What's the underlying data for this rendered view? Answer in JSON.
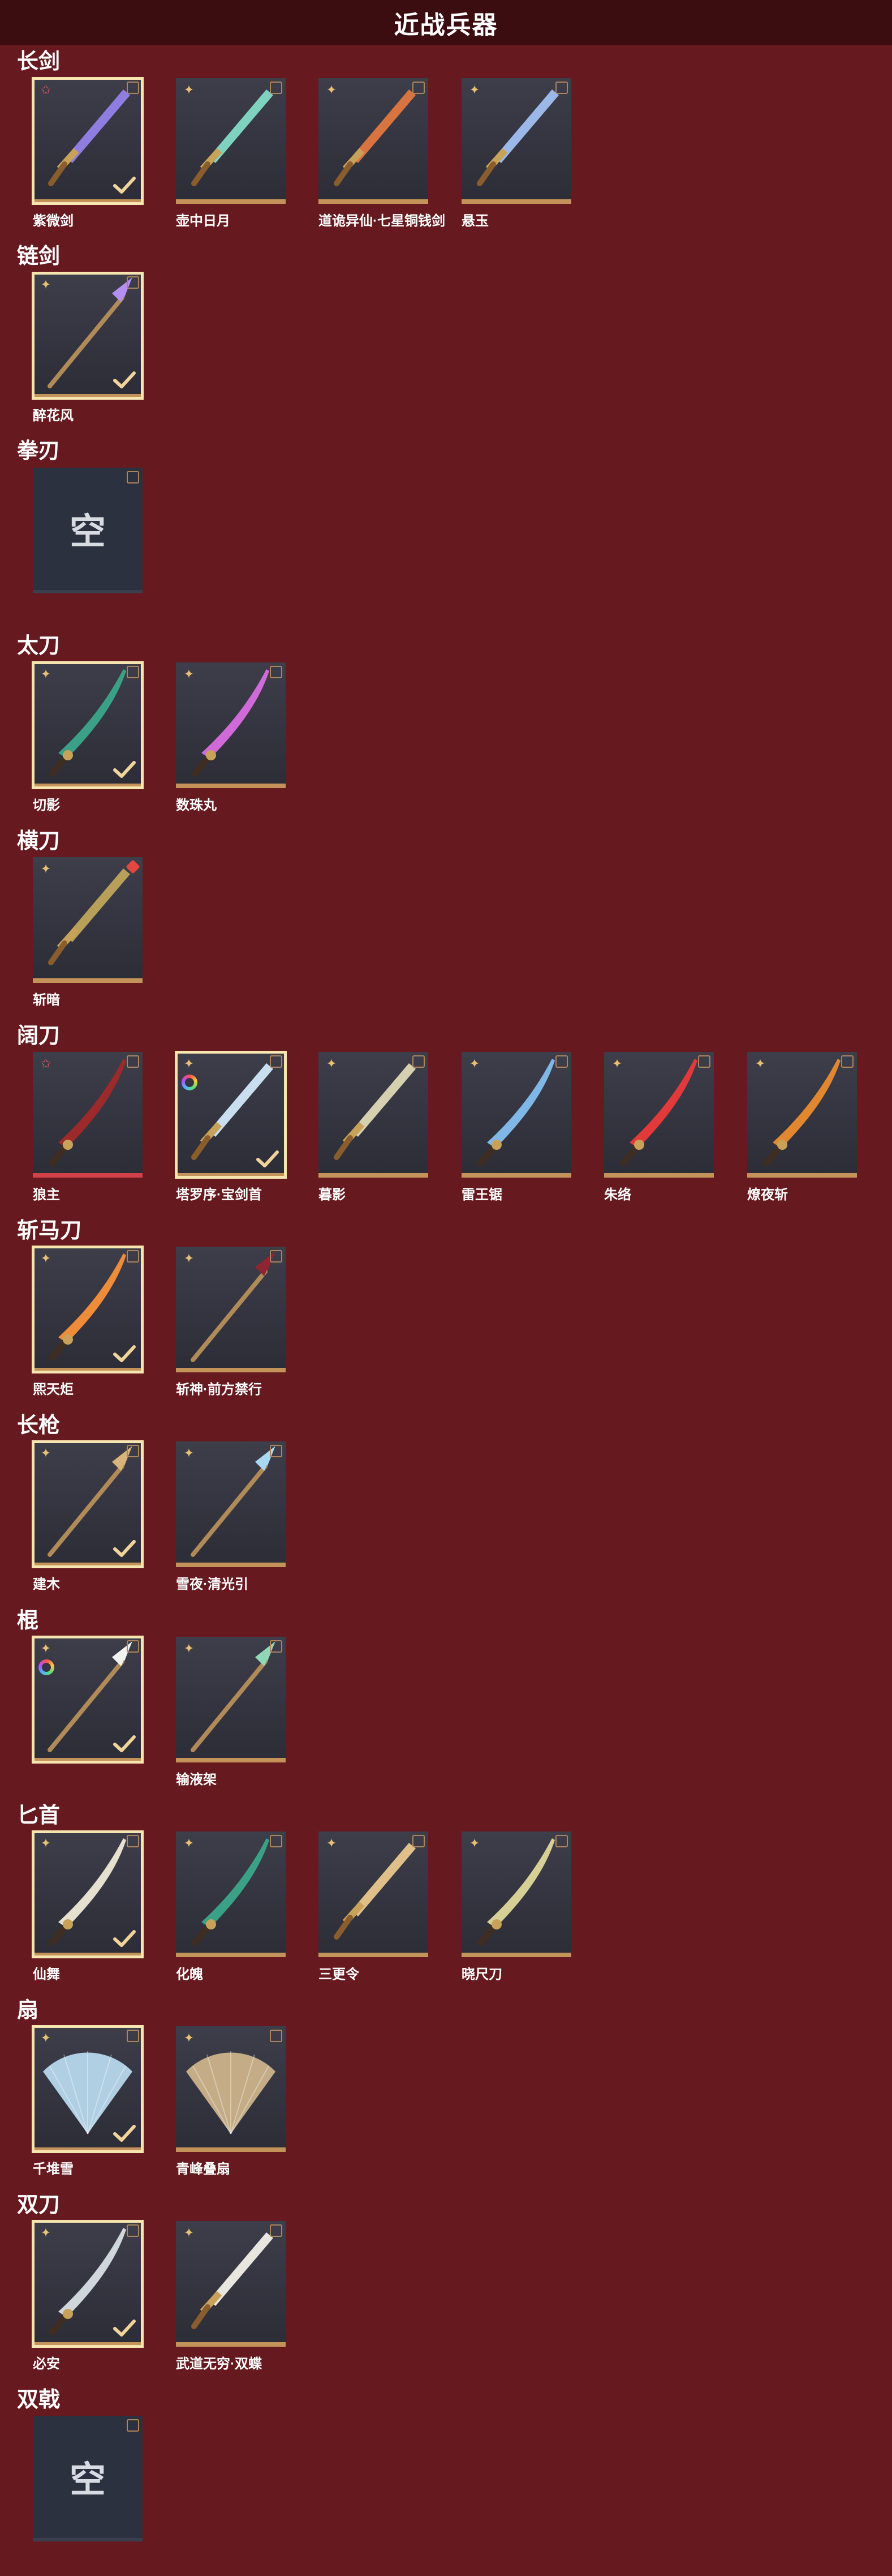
{
  "page_title": "近战兵器",
  "sections": [
    {
      "key": "long-sword",
      "label": "长剑"
    },
    {
      "key": "chain-sword",
      "label": "链剑"
    },
    {
      "key": "fist-blade",
      "label": "拳刃"
    },
    {
      "key": "tachi",
      "label": "太刀"
    },
    {
      "key": "heng-dao",
      "label": "横刀"
    },
    {
      "key": "broad-blade",
      "label": "阔刀"
    },
    {
      "key": "zhanma-dao",
      "label": "斩马刀"
    },
    {
      "key": "spear",
      "label": "长枪"
    },
    {
      "key": "staff",
      "label": "棍"
    },
    {
      "key": "dagger",
      "label": "匕首"
    },
    {
      "key": "fan",
      "label": "扇"
    },
    {
      "key": "dual-blades",
      "label": "双刀"
    },
    {
      "key": "dual-halberds",
      "label": "双戟"
    }
  ],
  "weapons": {
    "long_sword": [
      "紫微剑",
      "壶中日月",
      "道诡异仙·七星铜钱剑",
      "悬玉"
    ],
    "chain_sword": [
      "醉花风"
    ],
    "fist_blade_empty": "空",
    "tachi": [
      "切影",
      "数珠丸"
    ],
    "heng_dao": [
      "斩暗"
    ],
    "broad_blade": [
      "狼主",
      "塔罗序·宝剑首",
      "暮影",
      "雷王锯",
      "朱络",
      "燎夜斩"
    ],
    "zhanma_dao": [
      "煕天炬",
      "斩神·前方禁行"
    ],
    "spear": [
      "建木",
      "雪夜·清光引"
    ],
    "staff": [
      "",
      "输液架"
    ],
    "dagger": [
      "仙舞",
      "化魄",
      "三更令",
      "晓尺刀"
    ],
    "fan": [
      "千堆雪",
      "青峰叠扇"
    ],
    "dual_blades": [
      "必安",
      "武道无穷·双蝶"
    ],
    "dual_halberds_empty": "空"
  },
  "colors": {
    "background": "#661a1f",
    "title_bar": "#3b0c10",
    "slot_bg": "#34353f",
    "gold_border": "#c4935a",
    "equipped_outline": "#f7e5b0",
    "red_accent": "#d2404a"
  },
  "icons": {
    "grade_gold": "four-point-star-icon",
    "grade_red": "red-star-icon",
    "equipped": "check-icon",
    "rainbow": "rainbow-ring-icon",
    "corner": "corner-frame-icon"
  }
}
